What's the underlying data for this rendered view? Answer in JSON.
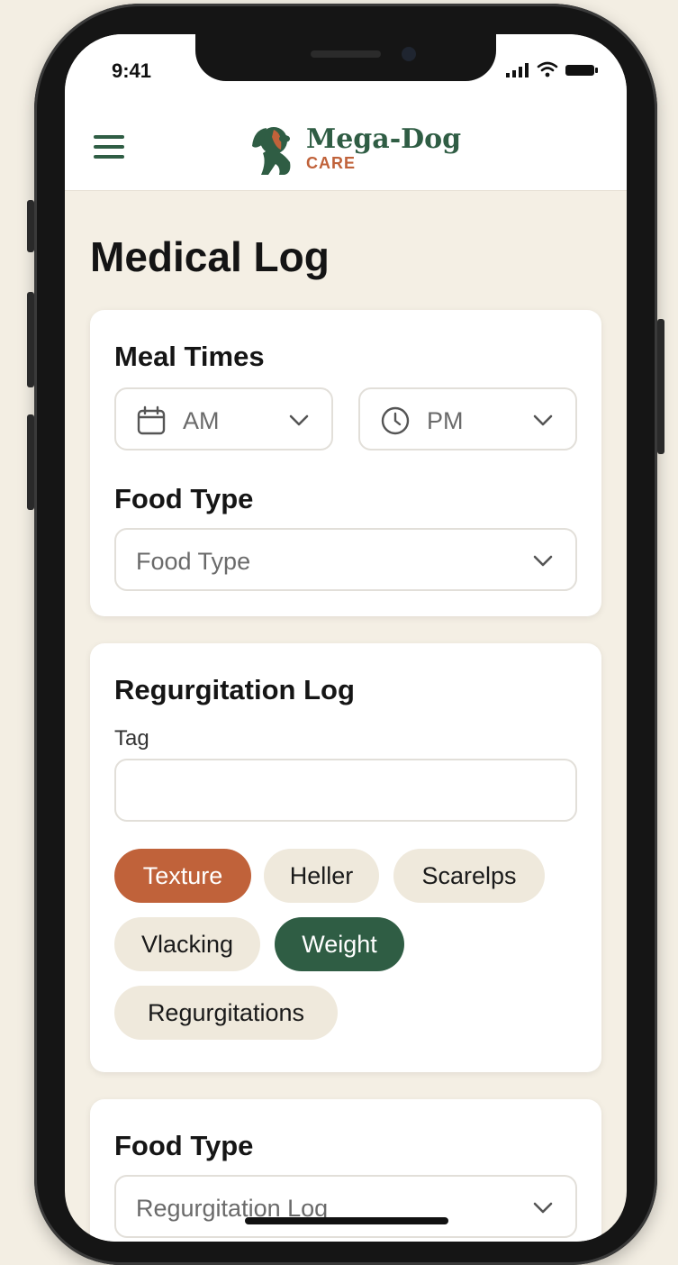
{
  "status_bar": {
    "time": "9:41"
  },
  "brand": {
    "name": "Mega-Dog",
    "tagline": "CARE",
    "primary_color": "#2f5d44",
    "accent_color": "#c0623a"
  },
  "page": {
    "title": "Medical Log"
  },
  "meal_card": {
    "title": "Meal Times",
    "am_select": {
      "value": "AM",
      "icon": "calendar-icon"
    },
    "pm_select": {
      "value": "PM",
      "icon": "clock-icon"
    },
    "food_type_title": "Food Type",
    "food_type_select": {
      "placeholder": "Food Type"
    }
  },
  "regurgitation_card": {
    "title": "Regurgitation Log",
    "tag_label": "Tag",
    "tag_input": {
      "value": ""
    },
    "chips": [
      {
        "label": "Texture",
        "state": "selected-accent",
        "color": "#c0623a"
      },
      {
        "label": "Heller",
        "state": "default"
      },
      {
        "label": "Scarelps",
        "state": "default"
      },
      {
        "label": "Vlacking",
        "state": "default"
      },
      {
        "label": "Weight",
        "state": "selected-primary",
        "color": "#2f5d44"
      },
      {
        "label": "Regurgitations",
        "state": "default"
      }
    ]
  },
  "food_card": {
    "title": "Food Type",
    "select": {
      "value": "Regurgitation Log"
    }
  }
}
